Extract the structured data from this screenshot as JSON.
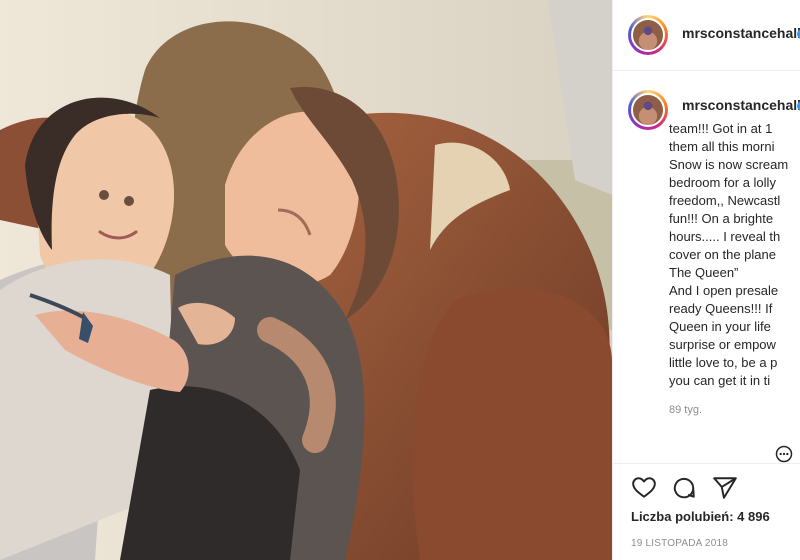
{
  "post": {
    "username": "mrsconstancehall",
    "caption_lines": [
      "team!!! Got in at 1",
      "them all this morni",
      "Snow is now scream",
      "bedroom for a lolly",
      "freedom,, Newcastl",
      "fun!!! On a brighte",
      "hours..... I reveal th",
      "cover on the plane",
      "The Queen”",
      "And I open presale",
      "ready Queens!!! If",
      "Queen in your life",
      "surprise or empow",
      "little love to, be a p",
      "you can get it in ti"
    ],
    "time_ago": "89 tyg.",
    "likes_label": "Liczba polubień: 4 896",
    "date": "19 LISTOPADA 2018"
  },
  "icons": {
    "like": "heart-icon",
    "comment": "comment-icon",
    "share": "send-icon",
    "more": "more-icon",
    "verified": "verified-badge-icon"
  }
}
